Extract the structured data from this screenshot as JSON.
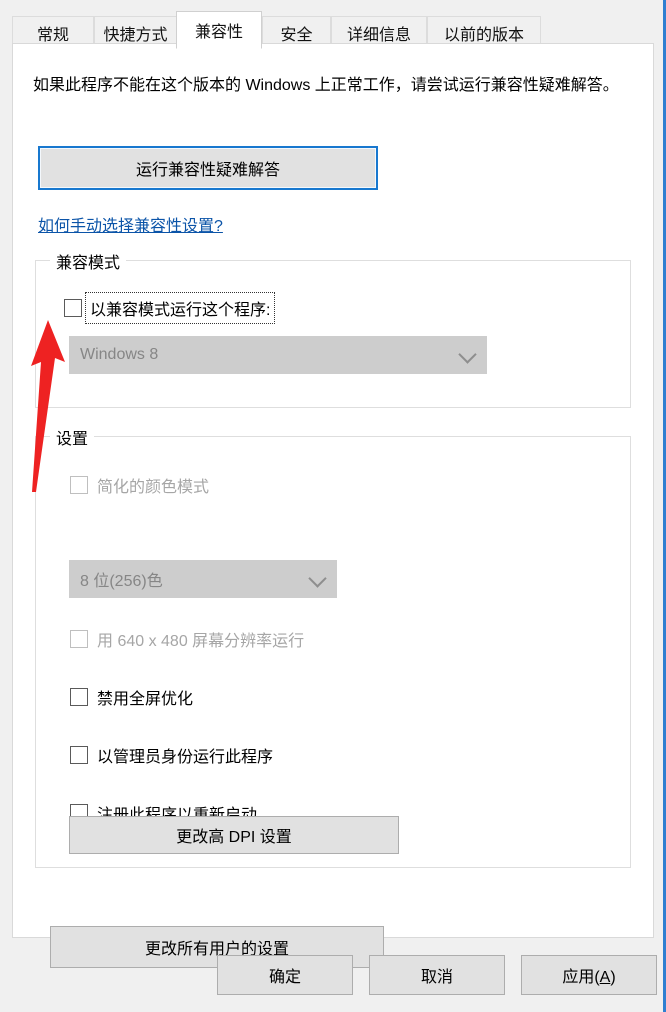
{
  "window": {
    "frame_color": "#2f7fd1",
    "background": "#f0f0f0"
  },
  "tabs": [
    {
      "label": "常规",
      "active": false
    },
    {
      "label": "快捷方式",
      "active": false
    },
    {
      "label": "兼容性",
      "active": true
    },
    {
      "label": "安全",
      "active": false
    },
    {
      "label": "详细信息",
      "active": false
    },
    {
      "label": "以前的版本",
      "active": false
    }
  ],
  "panel": {
    "intro_text": "如果此程序不能在这个版本的 Windows 上正常工作，请尝试运行兼容性疑难解答。",
    "troubleshoot_button": "运行兼容性疑难解答",
    "help_link": "如何手动选择兼容性设置?"
  },
  "compat_group": {
    "title": "兼容模式",
    "checkbox_label": "以兼容模式运行这个程序:",
    "checkbox_checked": false,
    "checkbox_focused": true,
    "os_combo_value": "Windows 8",
    "os_combo_disabled": true
  },
  "settings_group": {
    "title": "设置",
    "reduced_color_label": "简化的颜色模式",
    "reduced_color_checked": false,
    "reduced_color_disabled": true,
    "color_combo_value": "8 位(256)色",
    "color_combo_disabled": true,
    "resolution_label": "用 640 x 480 屏幕分辨率运行",
    "resolution_checked": false,
    "resolution_disabled": true,
    "fullscreen_opt_label": "禁用全屏优化",
    "fullscreen_opt_checked": false,
    "admin_label": "以管理员身份运行此程序",
    "admin_checked": false,
    "restart_label": "注册此程序以重新启动",
    "restart_checked": false,
    "dpi_button": "更改高 DPI 设置"
  },
  "all_users_button": "更改所有用户的设置",
  "dialog_buttons": {
    "ok": "确定",
    "cancel": "取消",
    "apply_prefix": "应用(",
    "apply_accel": "A",
    "apply_suffix": ")"
  },
  "annotation": {
    "arrow_color": "#ee2222"
  }
}
